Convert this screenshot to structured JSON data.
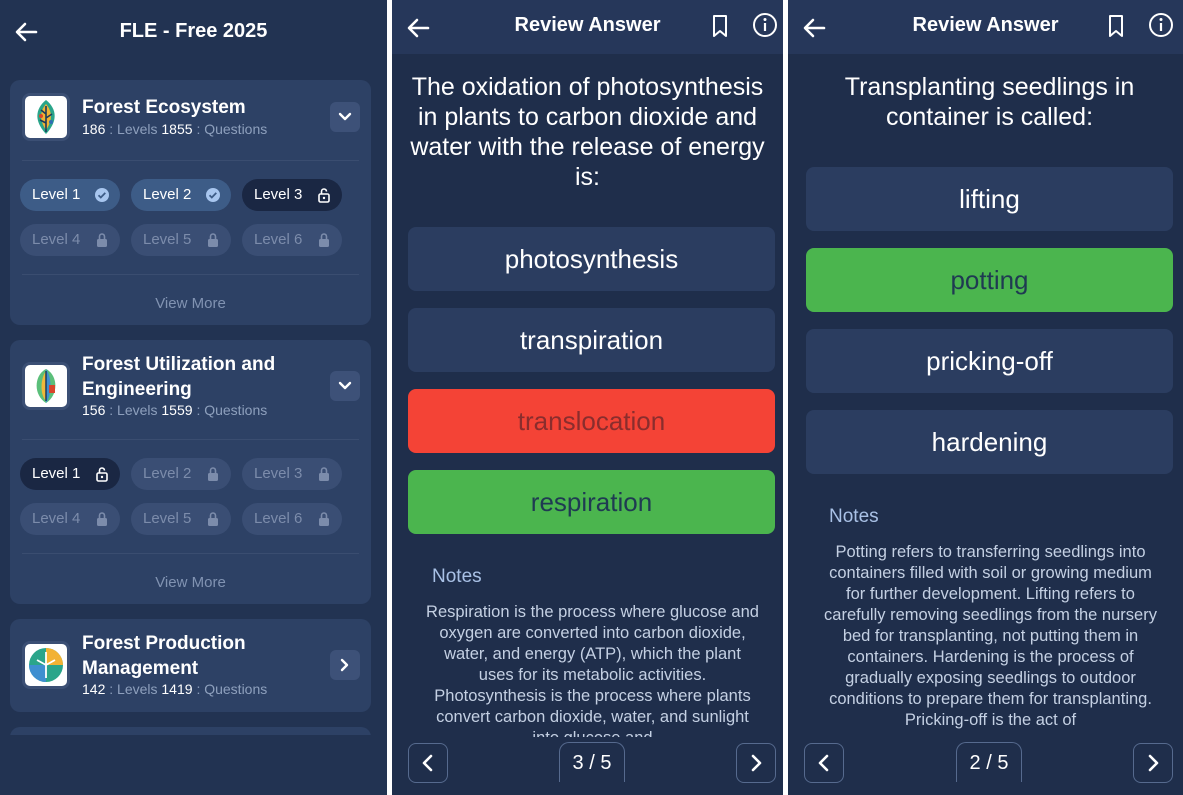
{
  "home": {
    "title": "FLE - Free 2025",
    "categories": [
      {
        "title": "Forest Ecosystem",
        "levels_count": "186",
        "levels_label": ": Levels",
        "questions_count": "1855",
        "questions_label": ": Questions",
        "levels": [
          {
            "label": "Level 1",
            "state": "completed"
          },
          {
            "label": "Level 2",
            "state": "completed"
          },
          {
            "label": "Level 3",
            "state": "unlocked"
          },
          {
            "label": "Level 4",
            "state": "locked"
          },
          {
            "label": "Level 5",
            "state": "locked"
          },
          {
            "label": "Level 6",
            "state": "locked"
          }
        ],
        "view_more": "View More"
      },
      {
        "title": "Forest Utilization and Engineering",
        "levels_count": "156",
        "levels_label": ": Levels",
        "questions_count": "1559",
        "questions_label": ": Questions",
        "levels": [
          {
            "label": "Level 1",
            "state": "unlocked"
          },
          {
            "label": "Level 2",
            "state": "locked"
          },
          {
            "label": "Level 3",
            "state": "locked"
          },
          {
            "label": "Level 4",
            "state": "locked"
          },
          {
            "label": "Level 5",
            "state": "locked"
          },
          {
            "label": "Level 6",
            "state": "locked"
          }
        ],
        "view_more": "View More"
      },
      {
        "title": "Forest Production Management",
        "levels_count": "142",
        "levels_label": ": Levels",
        "questions_count": "1419",
        "questions_label": ": Questions"
      }
    ]
  },
  "review1": {
    "title": "Review Answer",
    "question": "The oxidation of photosynthesis in plants to carbon dioxide and water with the release of energy is:",
    "options": [
      {
        "label": "photosynthesis",
        "state": "neutral"
      },
      {
        "label": "transpiration",
        "state": "neutral"
      },
      {
        "label": "translocation",
        "state": "wrong"
      },
      {
        "label": "respiration",
        "state": "correct"
      }
    ],
    "notes_label": "Notes",
    "notes": "Respiration is the process where glucose and oxygen are converted into carbon dioxide, water, and energy (ATP), which the plant uses for its metabolic activities. Photosynthesis is the process where plants convert carbon dioxide, water, and sunlight into glucose and",
    "counter": "3 / 5"
  },
  "review2": {
    "title": "Review Answer",
    "question": "Transplanting seedlings in container is called:",
    "options": [
      {
        "label": "lifting",
        "state": "neutral"
      },
      {
        "label": "potting",
        "state": "correct"
      },
      {
        "label": "pricking-off",
        "state": "neutral"
      },
      {
        "label": "hardening",
        "state": "neutral"
      }
    ],
    "notes_label": "Notes",
    "notes": "Potting refers to transferring seedlings into containers filled with soil or growing medium for further development. Lifting refers to carefully removing seedlings from the nursery bed for transplanting, not putting them in containers. Hardening is the process of gradually exposing seedlings to outdoor conditions to prepare them for transplanting. Pricking-off is the act of",
    "counter": "2 / 5"
  },
  "colors": {
    "correct": "#4bb54e",
    "wrong": "#f44336",
    "background": "#1f2e4b",
    "card": "#2d4165"
  }
}
